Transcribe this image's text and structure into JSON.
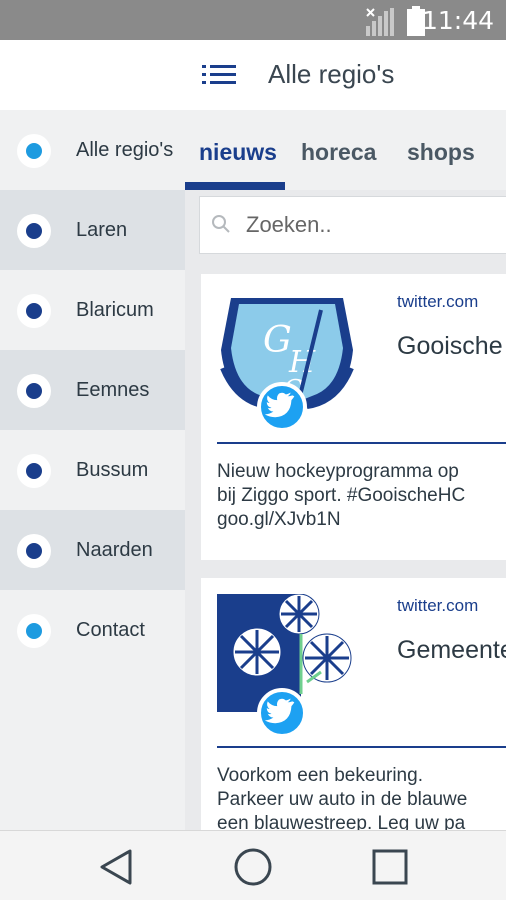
{
  "status_bar": {
    "time": "11:44",
    "icons": [
      "signal-icon",
      "battery-icon"
    ]
  },
  "header": {
    "title": "Alle regio's",
    "menu_icon": "hamburger-menu-icon"
  },
  "sidebar": {
    "items": [
      {
        "label": "Alle regio's",
        "dot_color": "#1e9be0"
      },
      {
        "label": "Laren",
        "dot_color": "#1a3e8c"
      },
      {
        "label": "Blaricum",
        "dot_color": "#1a3e8c"
      },
      {
        "label": "Eemnes",
        "dot_color": "#1a3e8c"
      },
      {
        "label": "Bussum",
        "dot_color": "#1a3e8c"
      },
      {
        "label": "Naarden",
        "dot_color": "#1a3e8c"
      },
      {
        "label": "Contact",
        "dot_color": "#1e9be0"
      }
    ]
  },
  "tabs": [
    {
      "label": "nieuws",
      "active": true
    },
    {
      "label": "horeca",
      "active": false
    },
    {
      "label": "shops",
      "active": false
    }
  ],
  "search": {
    "placeholder": "Zoeken.."
  },
  "feed": [
    {
      "source": "twitter.com",
      "title": "Gooische",
      "body": "Nieuw hockeyprogramma op\nbij Ziggo sport. #GooischeHC\ngoo.gl/XJvb1N",
      "badge_icon": "twitter-icon"
    },
    {
      "source": "twitter.com",
      "title": "Gemeente",
      "body": "Voorkom een bekeuring.\nParkeer uw auto in de blauwe\neen blauwestreep. Leg uw pa",
      "badge_icon": "twitter-icon"
    }
  ],
  "colors": {
    "brand": "#1a3e8c",
    "accent": "#1e9be0",
    "twitter": "#1da1f2"
  }
}
